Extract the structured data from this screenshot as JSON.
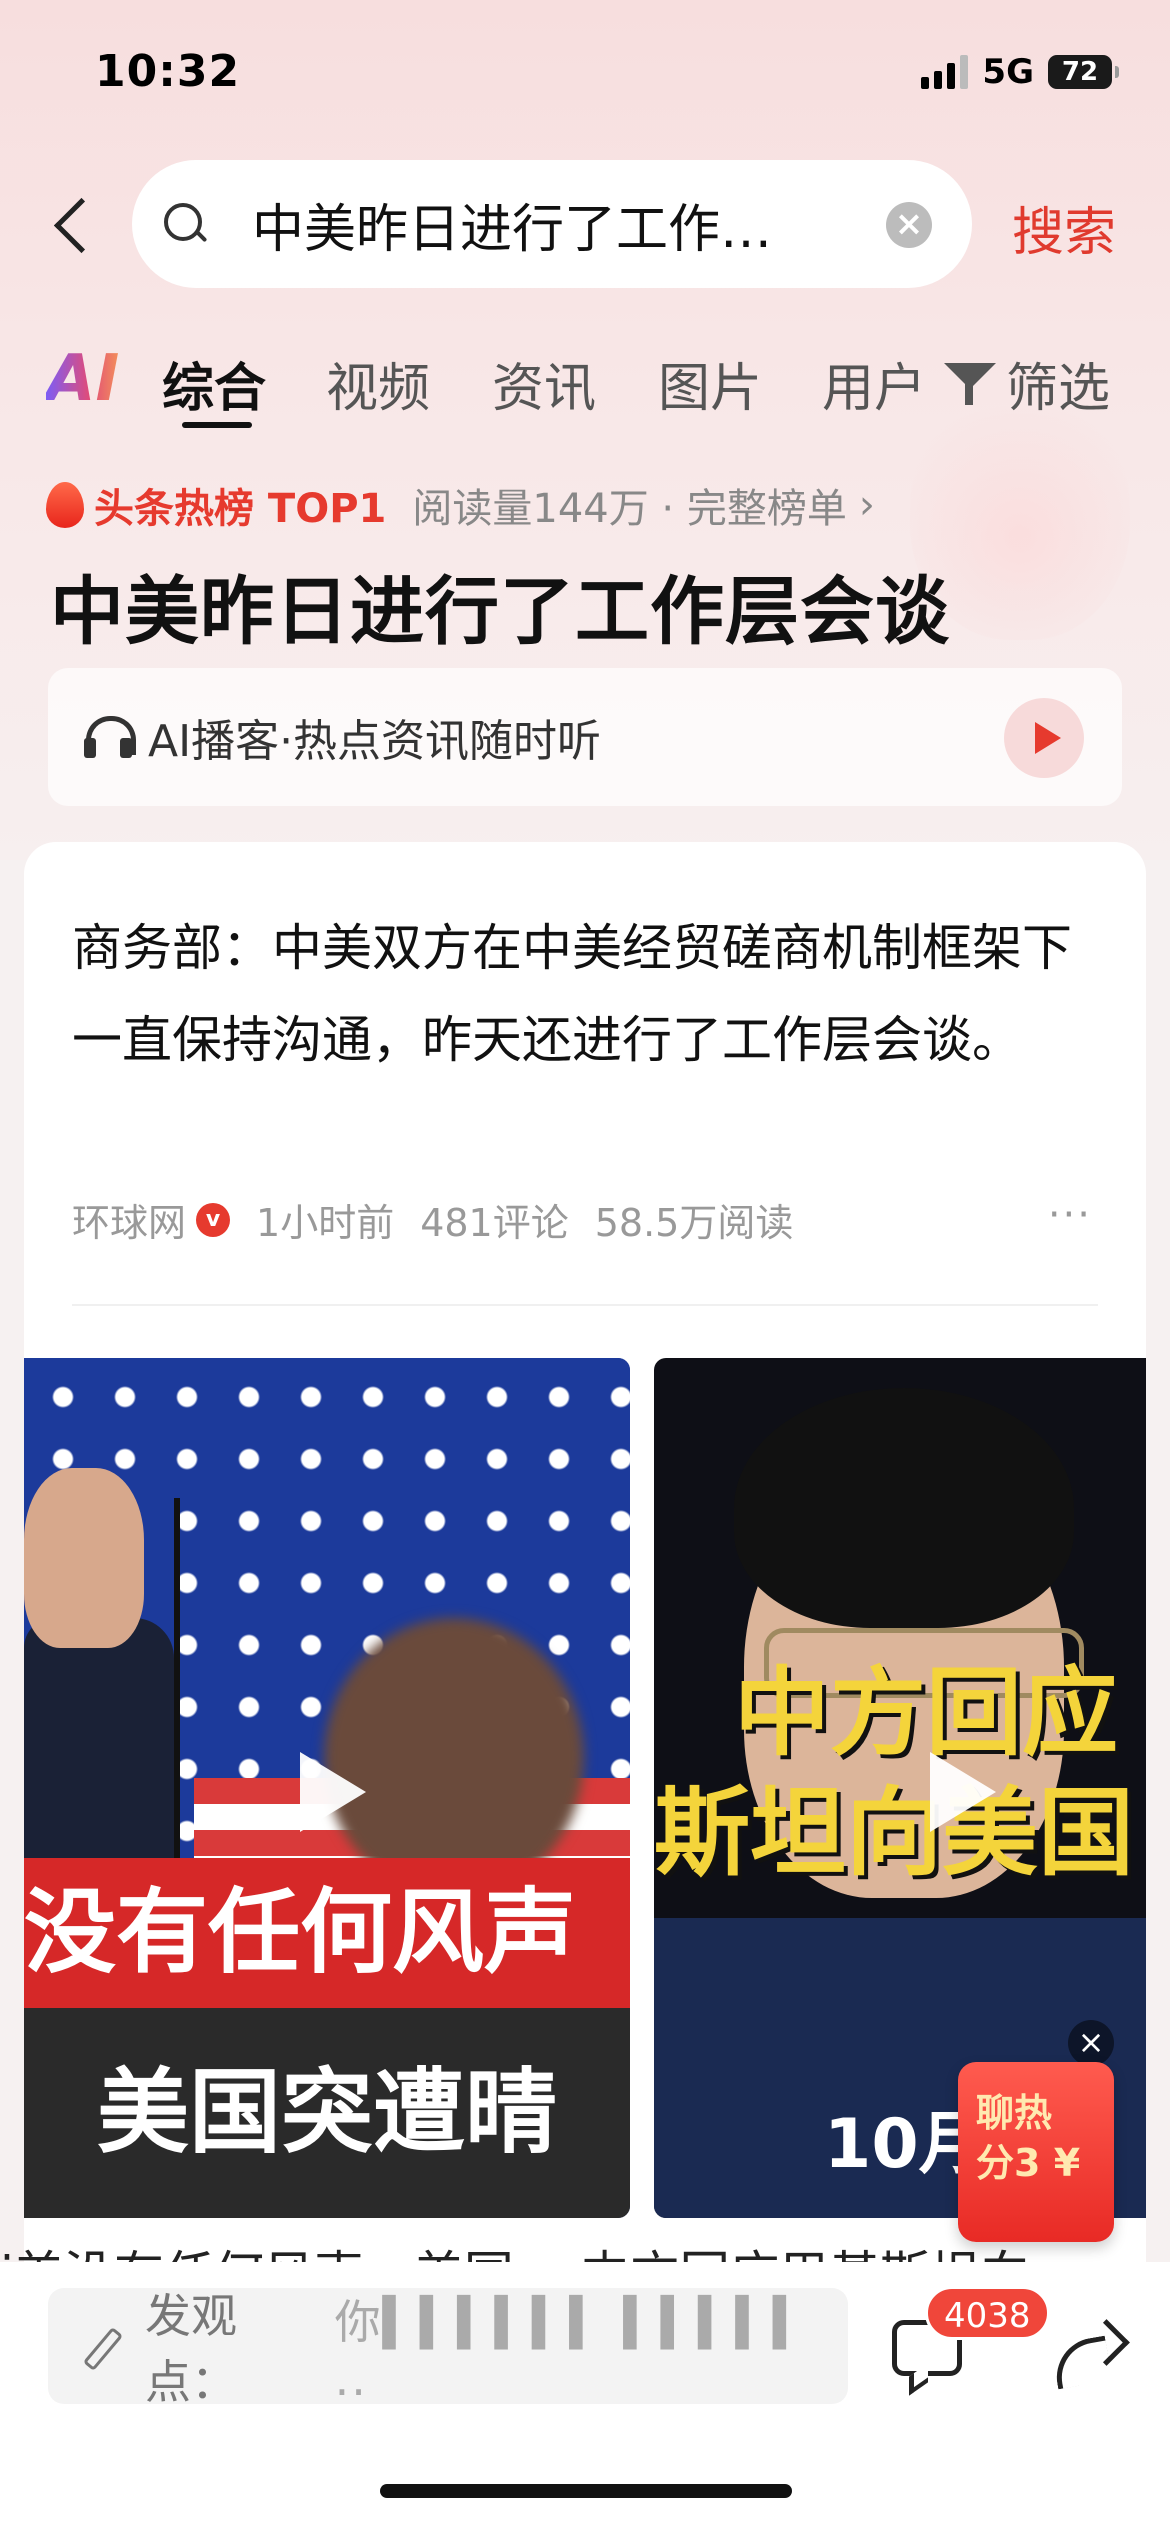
{
  "status_bar": {
    "time": "10:32",
    "network": "5G",
    "battery": "72"
  },
  "search": {
    "query": "中美昨日进行了工作…",
    "submit_label": "搜索"
  },
  "tabs": {
    "ai_label": "AI",
    "items": [
      "综合",
      "视频",
      "资讯",
      "图片",
      "用户"
    ],
    "filter_label": "筛选"
  },
  "hot": {
    "label": "头条热榜 TOP1",
    "meta": "阅读量144万 · 完整榜单",
    "chevron": "›"
  },
  "headline": "中美昨日进行了工作层会谈",
  "podcast": {
    "label": "AI播客·热点资讯随时听"
  },
  "article": {
    "text": "商务部：中美双方在中美经贸磋商机制框架下一直保持沟通，昨天还进行了工作层会谈。",
    "source": "环球网",
    "verified": "v",
    "time": "1小时前",
    "comments": "481评论",
    "reads": "58.5万阅读",
    "more": "···"
  },
  "videos": [
    {
      "banner": "没有任何风声",
      "bottom": "美国突遭晴"
    },
    {
      "line1": "中方回应",
      "line2": "斯坦向美国",
      "date": "10月"
    }
  ],
  "float_card": {
    "line1": "聊热",
    "line2": "分3",
    "currency": "¥",
    "close": "×"
  },
  "truncated_titles": "i美没有任何风声，美国…  中方回应巴基斯坦向…",
  "bottom_bar": {
    "input_label": "发观点：",
    "input_hint": "你▍▍▍▍▍▍ ▍▍▍▍▍ ..",
    "comment_count": "4038"
  }
}
